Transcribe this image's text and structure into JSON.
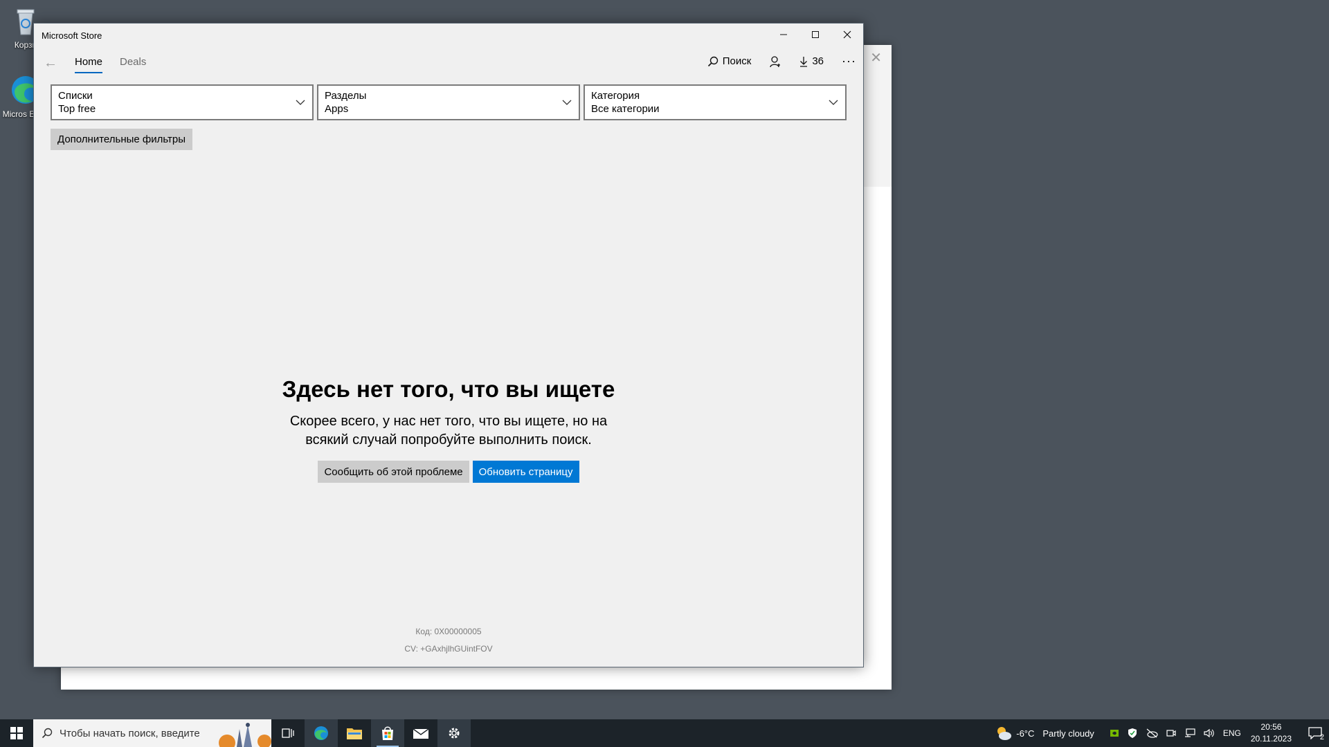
{
  "desktop": {
    "icons": [
      {
        "label": "Корзи",
        "icon": "recycle-bin-icon"
      },
      {
        "label": "Micros Edge",
        "icon": "edge-icon"
      }
    ]
  },
  "window": {
    "title": "Microsoft Store",
    "controls": {
      "minimize": "—",
      "maximize": "☐",
      "close": "✕"
    }
  },
  "nav": {
    "back": "←",
    "tabs": [
      {
        "label": "Home",
        "active": true
      },
      {
        "label": "Deals",
        "active": false
      }
    ],
    "search_label": "Поиск",
    "downloads_count": "36",
    "more": "···"
  },
  "filters": [
    {
      "label": "Списки",
      "value": "Top free"
    },
    {
      "label": "Разделы",
      "value": "Apps"
    },
    {
      "label": "Категория",
      "value": "Все категории"
    }
  ],
  "more_filters_label": "Дополнительные фильтры",
  "empty_state": {
    "title": "Здесь нет того, что вы ищете",
    "message": "Скорее всего, у нас нет того, что вы ищете, но на всякий случай попробуйте выполнить поиск.",
    "report_button": "Сообщить об этой проблеме",
    "refresh_button": "Обновить страницу"
  },
  "footer": {
    "code": "Код: 0X00000005",
    "cv": "CV: +GAxhjlhGUintFOV"
  },
  "taskbar": {
    "search_placeholder": "Чтобы начать поиск, введите",
    "apps": [
      "task-view-icon",
      "edge-icon",
      "file-explorer-icon",
      "store-icon",
      "mail-icon",
      "settings-icon"
    ],
    "weather": {
      "temp": "-6°C",
      "condition": "Partly cloudy"
    },
    "language": "ENG",
    "time": "20:56",
    "date": "20.11.2023",
    "notifications": "2"
  },
  "colors": {
    "accent": "#0078d4",
    "tab_underline": "#0067c0",
    "taskbar": "#1c2329"
  }
}
